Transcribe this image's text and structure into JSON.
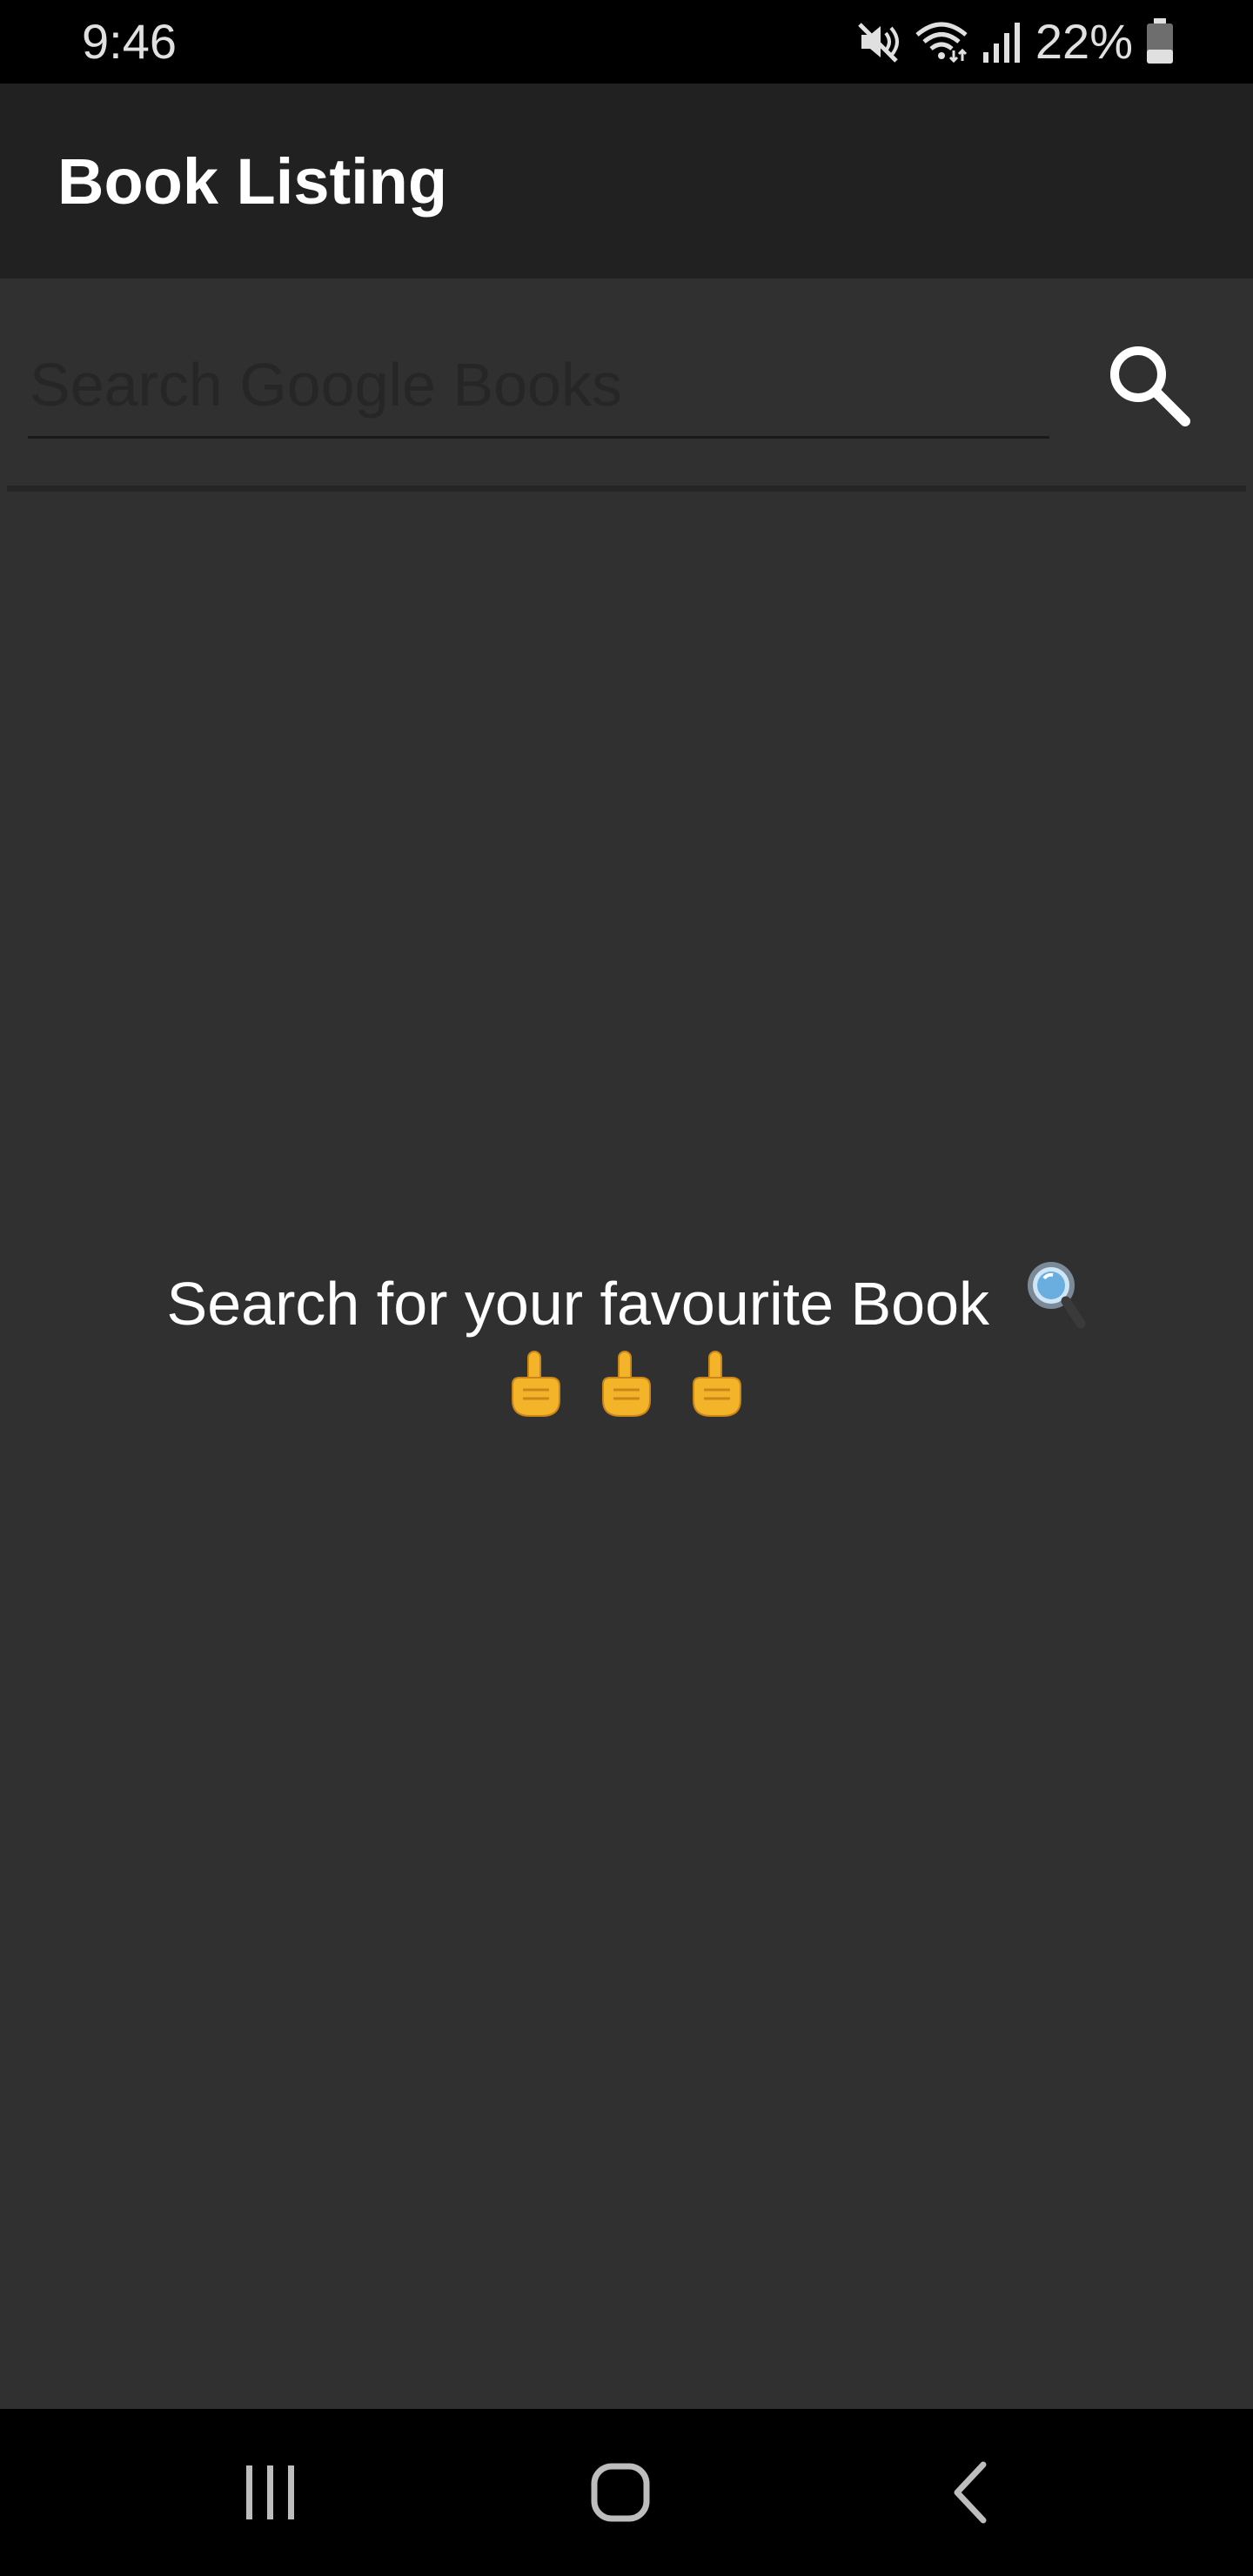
{
  "status_bar": {
    "time": "9:46",
    "battery_percent": "22%",
    "icons": [
      "mute-icon",
      "wifi-icon",
      "signal-icon",
      "battery-icon"
    ]
  },
  "app_bar": {
    "title": "Book Listing"
  },
  "search": {
    "placeholder": "Search Google Books",
    "value": "",
    "button_icon": "search-icon"
  },
  "empty_state": {
    "message": "Search for your favourite Book",
    "message_icon": "magnifying-glass-emoji",
    "emoji_icons": [
      "pointing-up-emoji",
      "pointing-up-emoji",
      "pointing-up-emoji"
    ]
  },
  "nav_bar": {
    "buttons": [
      "recents-icon",
      "home-icon",
      "back-icon"
    ]
  },
  "colors": {
    "background": "#303030",
    "app_bar": "#212121",
    "status_bar": "#000000",
    "text_primary": "#ffffff",
    "emoji_yellow": "#f4b429"
  }
}
